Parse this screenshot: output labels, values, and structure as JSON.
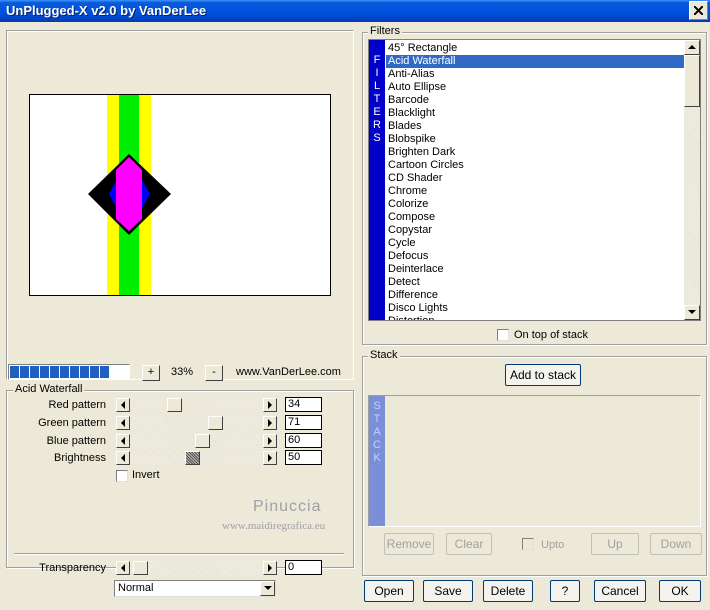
{
  "window": {
    "title": "UnPlugged-X v2.0 by VanDerLee"
  },
  "preview": {
    "zoom_minus": "-",
    "zoom_plus": "+",
    "zoom_value": "33%",
    "site_link": "www.VanDerLee.com",
    "progress_segments": 10
  },
  "params": {
    "group_title": "Acid Waterfall",
    "sliders": [
      {
        "label": "Red pattern",
        "value": "34"
      },
      {
        "label": "Green pattern",
        "value": "71"
      },
      {
        "label": "Blue pattern",
        "value": "60"
      },
      {
        "label": "Brightness",
        "value": "50"
      }
    ],
    "invert_label": "Invert",
    "watermark_name": "Pinuccia",
    "watermark_url": "www.maidiregrafica.eu"
  },
  "transparency": {
    "label": "Transparency",
    "value": "0",
    "blend_mode": "Normal"
  },
  "filters": {
    "group_title": "Filters",
    "tab_letters": [
      "F",
      "I",
      "L",
      "T",
      "E",
      "R",
      "S"
    ],
    "selected": "Acid Waterfall",
    "items": [
      "45° Rectangle",
      "Acid Waterfall",
      "Anti-Alias",
      "Auto Ellipse",
      "Barcode",
      "Blacklight",
      "Blades",
      "Blobspike",
      "Brighten Dark",
      "Cartoon Circles",
      "CD Shader",
      "Chrome",
      "Colorize",
      "Compose",
      "Copystar",
      "Cycle",
      "Defocus",
      "Deinterlace",
      "Detect",
      "Difference",
      "Disco Lights",
      "Distortion"
    ],
    "on_top_label": "On top of stack"
  },
  "stack": {
    "group_title": "Stack",
    "add_label": "Add to stack",
    "tab_letters": [
      "S",
      "T",
      "A",
      "C",
      "K"
    ],
    "remove_label": "Remove",
    "clear_label": "Clear",
    "upto_label": "Upto",
    "up_label": "Up",
    "down_label": "Down"
  },
  "buttons": {
    "open": "Open",
    "save": "Save",
    "delete": "Delete",
    "help": "?",
    "cancel": "Cancel",
    "ok": "OK"
  },
  "colors": {
    "title_bar": "#0053e1",
    "selection": "#316ac5",
    "filters_tab": "#0000c8",
    "stack_tab": "#7a8fd8",
    "progress": "#1f5fbf"
  }
}
